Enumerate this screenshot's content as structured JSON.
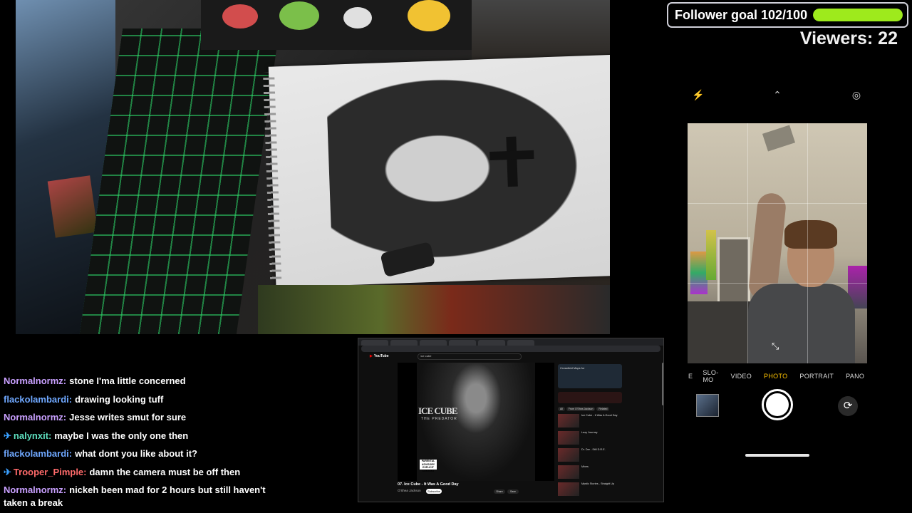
{
  "overlay": {
    "follower_goal_text": "Follower goal 102/100",
    "follower_progress": 1.0,
    "goal_bar_color": "#9eea1c",
    "viewers_text": "Viewers: 22"
  },
  "camera_app": {
    "top_icons": [
      "flash-off-icon",
      "chevron-up-icon",
      "live-photo-off-icon"
    ],
    "modes": [
      "SLO-MO",
      "VIDEO",
      "PHOTO",
      "PORTRAIT",
      "PANO"
    ],
    "active_mode": "PHOTO",
    "mode_partial_left": "E",
    "accent_color": "#ffc400"
  },
  "chat": {
    "messages": [
      {
        "user": "Normalnormz:",
        "text": "stone I'ma little concerned",
        "color": "#c9a0ff",
        "badge": ""
      },
      {
        "user": "flackolambardi:",
        "text": "drawing looking tuff",
        "color": "#6fa8ff",
        "badge": ""
      },
      {
        "user": "Normalnormz:",
        "text": "Jesse writes smut for sure",
        "color": "#c9a0ff",
        "badge": ""
      },
      {
        "user": "nalynxit:",
        "text": "maybe I was the only one then",
        "color": "#5ee0c0",
        "badge": "✈"
      },
      {
        "user": "flackolambardi:",
        "text": "what dont you like about it?",
        "color": "#6fa8ff",
        "badge": ""
      },
      {
        "user": "Trooper_Pimple:",
        "text": "damn the camera must be off then",
        "color": "#ff6a6a",
        "badge": "✈"
      },
      {
        "user": "Normalnormz:",
        "text": "nickeh been mad for 2 hours but still haven't taken a break",
        "color": "#c9a0ff",
        "badge": ""
      }
    ]
  },
  "shared_screen": {
    "search_query": "ice cube",
    "album_title": "ICE CUBE",
    "album_subtitle": "THE PREDATOR",
    "advisory": "PARENTAL ADVISORY EXPLICIT CONTENT",
    "video_title": "07. Ice Cube - It Was A Good Day",
    "channel": "O'Shea Jackson",
    "subscribe_label": "Subscribe",
    "actions": [
      "Share",
      "Save"
    ],
    "yt_logo": "YouTube",
    "sidebar_ad_title": "Crossfield Maps for",
    "chips": [
      "All",
      "From O'Shea Jackson",
      "Related"
    ],
    "recommendations": [
      {
        "title": "Ice Cube - It Was A Good Day"
      },
      {
        "title": "Lazy Journey"
      },
      {
        "title": "Dr. Dre - Still D.R.E."
      },
      {
        "title": "Mixes"
      },
      {
        "title": "Mystic Stories - Straight Up"
      }
    ]
  }
}
